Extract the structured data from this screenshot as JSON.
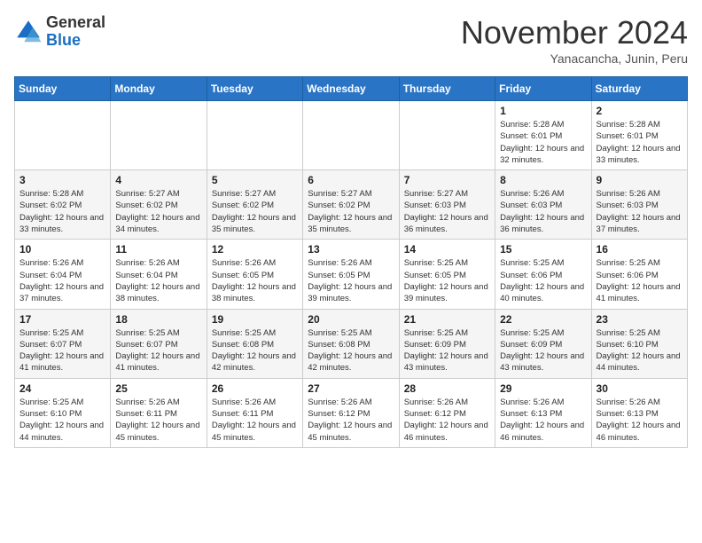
{
  "logo": {
    "general": "General",
    "blue": "Blue"
  },
  "header": {
    "month": "November 2024",
    "location": "Yanacancha, Junin, Peru"
  },
  "weekdays": [
    "Sunday",
    "Monday",
    "Tuesday",
    "Wednesday",
    "Thursday",
    "Friday",
    "Saturday"
  ],
  "weeks": [
    [
      {
        "day": "",
        "info": ""
      },
      {
        "day": "",
        "info": ""
      },
      {
        "day": "",
        "info": ""
      },
      {
        "day": "",
        "info": ""
      },
      {
        "day": "",
        "info": ""
      },
      {
        "day": "1",
        "info": "Sunrise: 5:28 AM\nSunset: 6:01 PM\nDaylight: 12 hours and 32 minutes."
      },
      {
        "day": "2",
        "info": "Sunrise: 5:28 AM\nSunset: 6:01 PM\nDaylight: 12 hours and 33 minutes."
      }
    ],
    [
      {
        "day": "3",
        "info": "Sunrise: 5:28 AM\nSunset: 6:02 PM\nDaylight: 12 hours and 33 minutes."
      },
      {
        "day": "4",
        "info": "Sunrise: 5:27 AM\nSunset: 6:02 PM\nDaylight: 12 hours and 34 minutes."
      },
      {
        "day": "5",
        "info": "Sunrise: 5:27 AM\nSunset: 6:02 PM\nDaylight: 12 hours and 35 minutes."
      },
      {
        "day": "6",
        "info": "Sunrise: 5:27 AM\nSunset: 6:02 PM\nDaylight: 12 hours and 35 minutes."
      },
      {
        "day": "7",
        "info": "Sunrise: 5:27 AM\nSunset: 6:03 PM\nDaylight: 12 hours and 36 minutes."
      },
      {
        "day": "8",
        "info": "Sunrise: 5:26 AM\nSunset: 6:03 PM\nDaylight: 12 hours and 36 minutes."
      },
      {
        "day": "9",
        "info": "Sunrise: 5:26 AM\nSunset: 6:03 PM\nDaylight: 12 hours and 37 minutes."
      }
    ],
    [
      {
        "day": "10",
        "info": "Sunrise: 5:26 AM\nSunset: 6:04 PM\nDaylight: 12 hours and 37 minutes."
      },
      {
        "day": "11",
        "info": "Sunrise: 5:26 AM\nSunset: 6:04 PM\nDaylight: 12 hours and 38 minutes."
      },
      {
        "day": "12",
        "info": "Sunrise: 5:26 AM\nSunset: 6:05 PM\nDaylight: 12 hours and 38 minutes."
      },
      {
        "day": "13",
        "info": "Sunrise: 5:26 AM\nSunset: 6:05 PM\nDaylight: 12 hours and 39 minutes."
      },
      {
        "day": "14",
        "info": "Sunrise: 5:25 AM\nSunset: 6:05 PM\nDaylight: 12 hours and 39 minutes."
      },
      {
        "day": "15",
        "info": "Sunrise: 5:25 AM\nSunset: 6:06 PM\nDaylight: 12 hours and 40 minutes."
      },
      {
        "day": "16",
        "info": "Sunrise: 5:25 AM\nSunset: 6:06 PM\nDaylight: 12 hours and 41 minutes."
      }
    ],
    [
      {
        "day": "17",
        "info": "Sunrise: 5:25 AM\nSunset: 6:07 PM\nDaylight: 12 hours and 41 minutes."
      },
      {
        "day": "18",
        "info": "Sunrise: 5:25 AM\nSunset: 6:07 PM\nDaylight: 12 hours and 41 minutes."
      },
      {
        "day": "19",
        "info": "Sunrise: 5:25 AM\nSunset: 6:08 PM\nDaylight: 12 hours and 42 minutes."
      },
      {
        "day": "20",
        "info": "Sunrise: 5:25 AM\nSunset: 6:08 PM\nDaylight: 12 hours and 42 minutes."
      },
      {
        "day": "21",
        "info": "Sunrise: 5:25 AM\nSunset: 6:09 PM\nDaylight: 12 hours and 43 minutes."
      },
      {
        "day": "22",
        "info": "Sunrise: 5:25 AM\nSunset: 6:09 PM\nDaylight: 12 hours and 43 minutes."
      },
      {
        "day": "23",
        "info": "Sunrise: 5:25 AM\nSunset: 6:10 PM\nDaylight: 12 hours and 44 minutes."
      }
    ],
    [
      {
        "day": "24",
        "info": "Sunrise: 5:25 AM\nSunset: 6:10 PM\nDaylight: 12 hours and 44 minutes."
      },
      {
        "day": "25",
        "info": "Sunrise: 5:26 AM\nSunset: 6:11 PM\nDaylight: 12 hours and 45 minutes."
      },
      {
        "day": "26",
        "info": "Sunrise: 5:26 AM\nSunset: 6:11 PM\nDaylight: 12 hours and 45 minutes."
      },
      {
        "day": "27",
        "info": "Sunrise: 5:26 AM\nSunset: 6:12 PM\nDaylight: 12 hours and 45 minutes."
      },
      {
        "day": "28",
        "info": "Sunrise: 5:26 AM\nSunset: 6:12 PM\nDaylight: 12 hours and 46 minutes."
      },
      {
        "day": "29",
        "info": "Sunrise: 5:26 AM\nSunset: 6:13 PM\nDaylight: 12 hours and 46 minutes."
      },
      {
        "day": "30",
        "info": "Sunrise: 5:26 AM\nSunset: 6:13 PM\nDaylight: 12 hours and 46 minutes."
      }
    ]
  ]
}
